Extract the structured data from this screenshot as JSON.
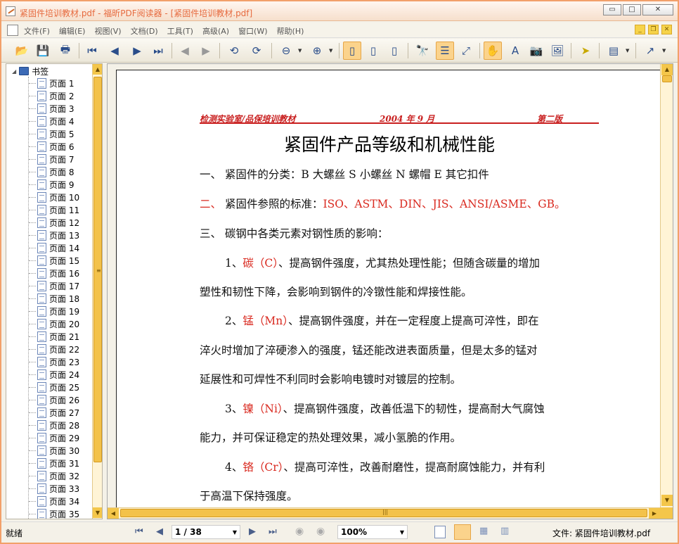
{
  "window": {
    "title": "紧固件培训教材.pdf - 福昕PDF阅读器 - [紧固件培训教材.pdf]",
    "buttons": {
      "minimize": "▭",
      "maximize": "□",
      "close": "✕"
    }
  },
  "menubar": {
    "items": [
      "文件(F)",
      "编辑(E)",
      "视图(V)",
      "文档(D)",
      "工具(T)",
      "高级(A)",
      "窗口(W)",
      "帮助(H)"
    ],
    "mdi": [
      "_",
      "❐",
      "✕"
    ]
  },
  "toolbar": {
    "icons": [
      "open-icon",
      "save-icon",
      "print-icon",
      "first-page-icon",
      "previous-page-icon",
      "next-page-icon",
      "last-page-icon",
      "back-icon",
      "forward-icon",
      "rotate-left-icon",
      "rotate-right-icon",
      "zoom-out-icon",
      "zoom-in-icon",
      "single-page-icon",
      "continuous-page-icon",
      "facing-page-icon",
      "find-icon",
      "bookmark-panel-icon",
      "fit-width-icon",
      "hand-tool-icon",
      "text-select-icon",
      "snapshot-icon",
      "image-select-icon",
      "select-icon",
      "annotation-icon",
      "arrow-tool-icon"
    ]
  },
  "sidebar": {
    "root_label": "书签",
    "bookmarks": [
      "页面 1",
      "页面 2",
      "页面 3",
      "页面 4",
      "页面 5",
      "页面 6",
      "页面 7",
      "页面 8",
      "页面 9",
      "页面 10",
      "页面 11",
      "页面 12",
      "页面 13",
      "页面 14",
      "页面 15",
      "页面 16",
      "页面 17",
      "页面 18",
      "页面 19",
      "页面 20",
      "页面 21",
      "页面 22",
      "页面 23",
      "页面 24",
      "页面 25",
      "页面 26",
      "页面 27",
      "页面 28",
      "页面 29",
      "页面 30",
      "页面 31",
      "页面 32",
      "页面 33",
      "页面 34",
      "页面 35"
    ]
  },
  "document": {
    "header_left": "检测实验室/品保培训教材",
    "header_center": "2004 年 9 月",
    "header_right": "第二版",
    "title": "紧固件产品等级和机械性能",
    "lines": [
      {
        "parts": [
          {
            "t": "一、   紧固件的分类：B 大螺丝 S 小螺丝 N 螺帽 E 其它扣件",
            "c": ""
          }
        ],
        "indent": false
      },
      {
        "parts": [
          {
            "t": "二、",
            "c": "red"
          },
          {
            "t": "   紧固件参照的标准：",
            "c": ""
          },
          {
            "t": "ISO、ASTM、DIN、JIS、ANSI/ASME、GB。",
            "c": "red"
          }
        ],
        "indent": false
      },
      {
        "parts": [
          {
            "t": "三、   碳钢中各类元素对钢性质的影响：",
            "c": ""
          }
        ],
        "indent": false
      },
      {
        "parts": [
          {
            "t": "1、",
            "c": ""
          },
          {
            "t": "碳（C）",
            "c": "red"
          },
          {
            "t": "、提高钢件强度，尤其热处理性能；但随含碳量的增加",
            "c": ""
          }
        ],
        "indent": true
      },
      {
        "parts": [
          {
            "t": "塑性和韧性下降，会影响到钢件的冷镦性能和焊接性能。",
            "c": ""
          }
        ],
        "indent": false
      },
      {
        "parts": [
          {
            "t": "2、",
            "c": ""
          },
          {
            "t": "锰（Mn）",
            "c": "red"
          },
          {
            "t": "、提高钢件强度，并在一定程度上提高可淬性，即在",
            "c": ""
          }
        ],
        "indent": true
      },
      {
        "parts": [
          {
            "t": "淬火时增加了淬硬渗入的强度，锰还能改进表面质量，但是太多的锰对",
            "c": ""
          }
        ],
        "indent": false
      },
      {
        "parts": [
          {
            "t": "延展性和可焊性不利同时会影响电镀时对镀层的控制。",
            "c": ""
          }
        ],
        "indent": false
      },
      {
        "parts": [
          {
            "t": "3、",
            "c": ""
          },
          {
            "t": "镍（Ni）",
            "c": "red"
          },
          {
            "t": "、提高钢件强度，改善低温下的韧性，提高耐大气腐蚀",
            "c": ""
          }
        ],
        "indent": true
      },
      {
        "parts": [
          {
            "t": "能力，并可保证稳定的热处理效果，减小氢脆的作用。",
            "c": ""
          }
        ],
        "indent": false
      },
      {
        "parts": [
          {
            "t": "4、",
            "c": ""
          },
          {
            "t": "铬（Cr）",
            "c": "red"
          },
          {
            "t": "、提高可淬性，改善耐磨性，提高耐腐蚀能力，并有利",
            "c": ""
          }
        ],
        "indent": true
      },
      {
        "parts": [
          {
            "t": "于高温下保持强度。",
            "c": ""
          }
        ],
        "indent": false
      }
    ]
  },
  "statusbar": {
    "status": "就绪",
    "page_display": "1 / 38",
    "zoom": "100%",
    "file_info": "文件: 紧固件培训教材.pdf"
  },
  "colors": {
    "accent": "#f2a06a",
    "red_text": "#d9291f",
    "scroll": "#f3c24a"
  }
}
